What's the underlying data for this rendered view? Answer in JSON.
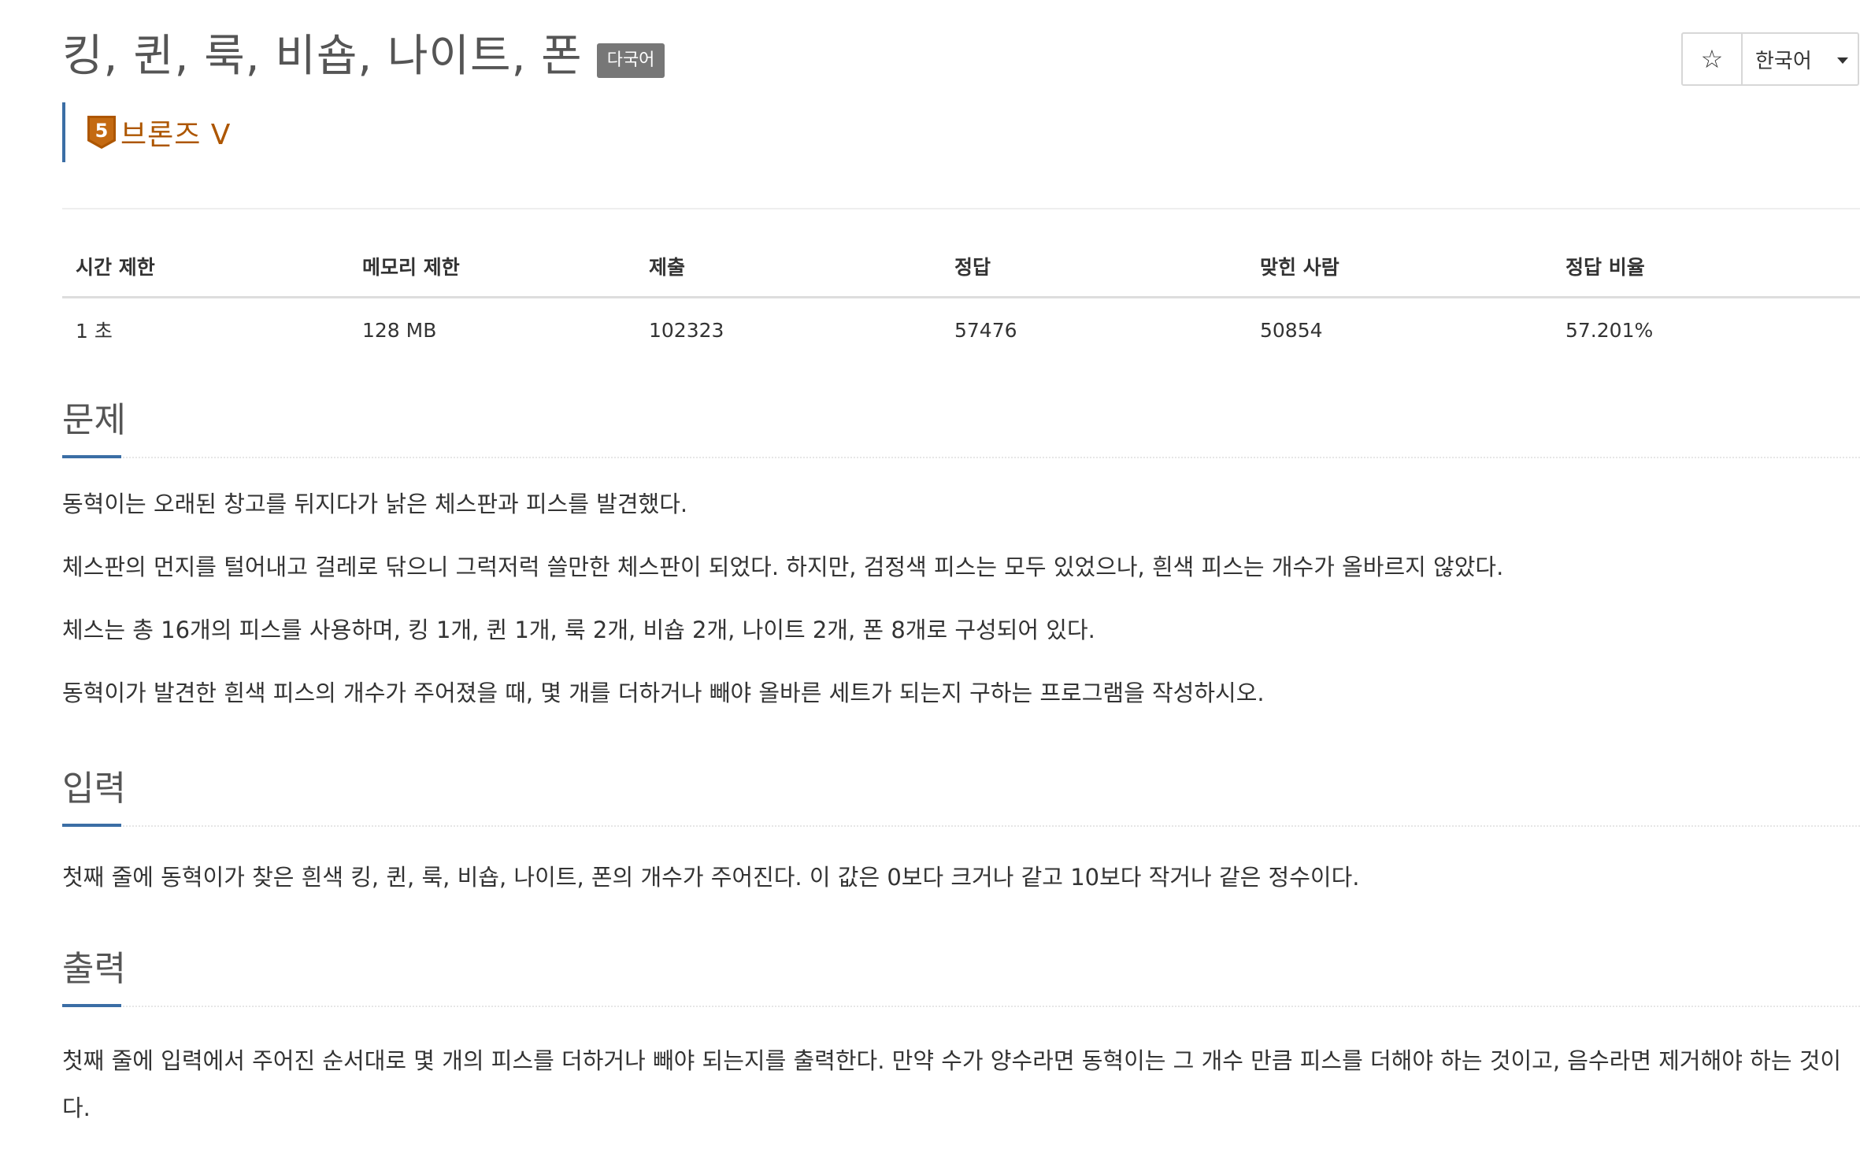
{
  "problem": {
    "title": "킹, 퀸, 룩, 비숍, 나이트, 폰",
    "language_badge": "다국어",
    "tier": "브론즈 V",
    "tier_icon": "bronze-tier-5-icon",
    "tier_icon_number": "5",
    "tier_color": "#ad5600"
  },
  "toolbar": {
    "star_icon": "☆",
    "language": "한국어"
  },
  "info": {
    "headers": [
      "시간 제한",
      "메모리 제한",
      "제출",
      "정답",
      "맞힌 사람",
      "정답 비율"
    ],
    "values": [
      "1 초",
      "128 MB",
      "102323",
      "57476",
      "50854",
      "57.201%"
    ]
  },
  "sections": {
    "description": {
      "title": "문제",
      "paragraphs": [
        "동혁이는 오래된 창고를 뒤지다가 낡은 체스판과 피스를 발견했다.",
        "체스판의 먼지를 털어내고 걸레로 닦으니 그럭저럭 쓸만한 체스판이 되었다. 하지만, 검정색 피스는 모두 있었으나, 흰색 피스는 개수가 올바르지 않았다.",
        "체스는 총 16개의 피스를 사용하며, 킹 1개, 퀸 1개, 룩 2개, 비숍 2개, 나이트 2개, 폰 8개로 구성되어 있다.",
        "동혁이가 발견한 흰색 피스의 개수가 주어졌을 때, 몇 개를 더하거나 빼야 올바른 세트가 되는지 구하는 프로그램을 작성하시오."
      ]
    },
    "input": {
      "title": "입력",
      "paragraphs": [
        "첫째 줄에 동혁이가 찾은 흰색 킹, 퀸, 룩, 비숍, 나이트, 폰의 개수가 주어진다. 이 값은 0보다 크거나 같고 10보다 작거나 같은 정수이다."
      ]
    },
    "output": {
      "title": "출력",
      "paragraphs": [
        "첫째 줄에 입력에서 주어진 순서대로 몇 개의 피스를 더하거나 빼야 되는지를 출력한다. 만약 수가 양수라면 동혁이는 그 개수 만큼 피스를 더해야 하는 것이고, 음수라면 제거해야 하는 것이다."
      ]
    }
  }
}
